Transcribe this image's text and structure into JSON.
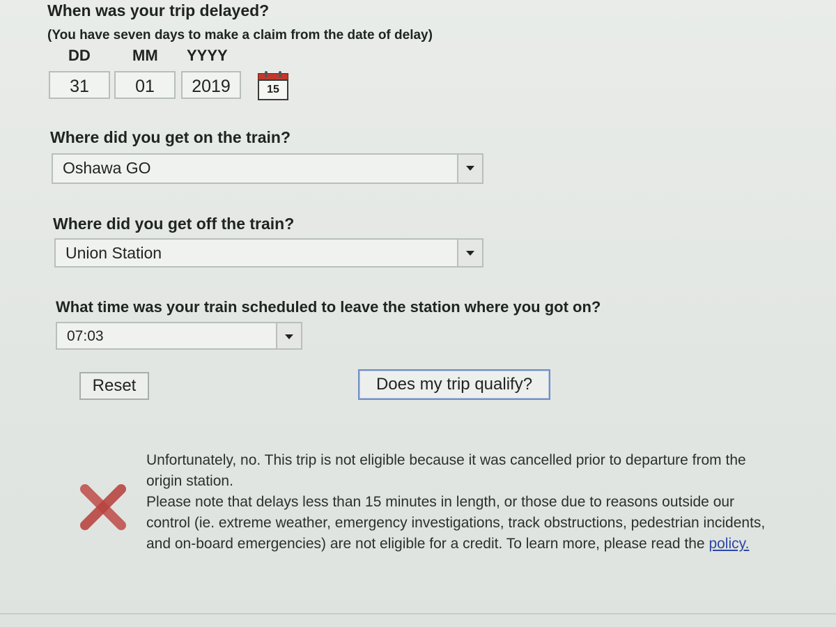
{
  "trip_date": {
    "question": "When was your trip delayed?",
    "note": "(You have seven days to make a claim from the date of delay)",
    "dd_label": "DD",
    "mm_label": "MM",
    "yyyy_label": "YYYY",
    "dd_value": "31",
    "mm_value": "01",
    "yyyy_value": "2019",
    "calendar_icon_text": "15"
  },
  "board": {
    "question": "Where did you get on the train?",
    "selected": "Oshawa GO"
  },
  "alight": {
    "question": "Where did you get off the train?",
    "selected": "Union Station"
  },
  "departure_time": {
    "question": "What time was your train scheduled to leave the station where you got on?",
    "selected": "07:03"
  },
  "actions": {
    "reset_label": "Reset",
    "qualify_label": "Does my trip qualify?"
  },
  "result": {
    "icon": "red-x-icon",
    "line1": "Unfortunately, no. This trip is not eligible because it was cancelled prior to departure from the origin station.",
    "line2": "Please note that delays less than 15 minutes in length, or those due to reasons outside our control (ie. extreme weather, emergency investigations, track obstructions, pedestrian incidents, and on-board emergencies) are not eligible for a credit. To learn more, please read the",
    "link_text": "policy."
  },
  "colors": {
    "link": "#2d45a8",
    "error": "#c0392b",
    "focus_border": "#6f8fc4"
  }
}
